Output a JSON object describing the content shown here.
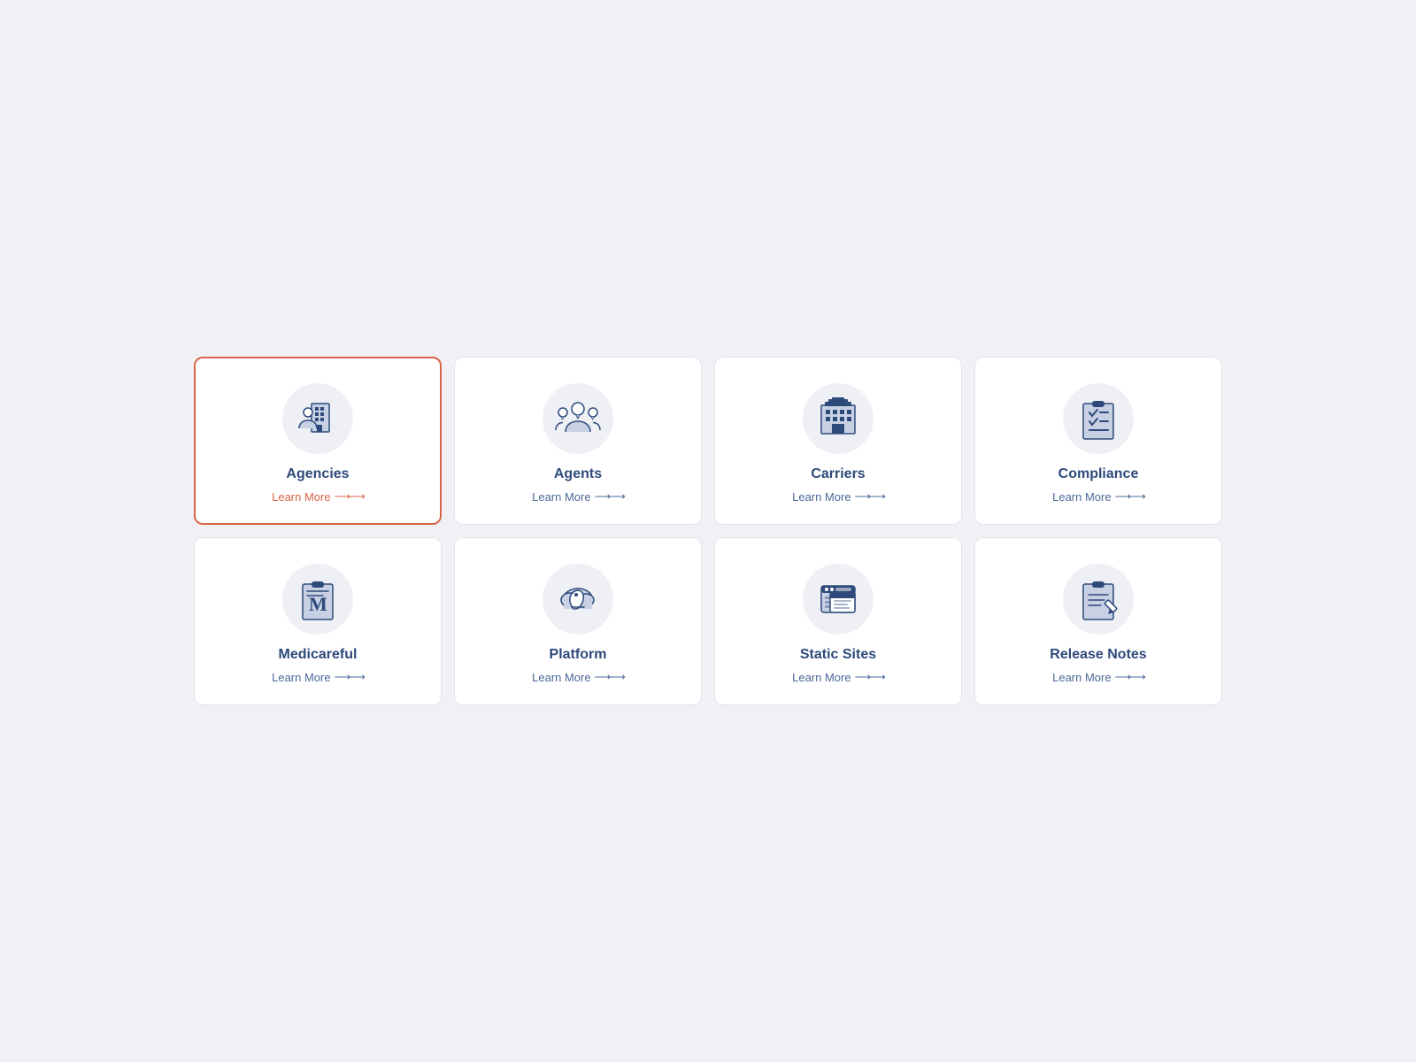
{
  "cards": [
    {
      "id": "agencies",
      "title": "Agencies",
      "link": "Learn More",
      "active": true
    },
    {
      "id": "agents",
      "title": "Agents",
      "link": "Learn More",
      "active": false
    },
    {
      "id": "carriers",
      "title": "Carriers",
      "link": "Learn More",
      "active": false
    },
    {
      "id": "compliance",
      "title": "Compliance",
      "link": "Learn More",
      "active": false
    },
    {
      "id": "medicareful",
      "title": "Medicareful",
      "link": "Learn More",
      "active": false
    },
    {
      "id": "platform",
      "title": "Platform",
      "link": "Learn More",
      "active": false
    },
    {
      "id": "static-sites",
      "title": "Static Sites",
      "link": "Learn More",
      "active": false
    },
    {
      "id": "release-notes",
      "title": "Release Notes",
      "link": "Learn More",
      "active": false
    }
  ],
  "arrows": "→→"
}
